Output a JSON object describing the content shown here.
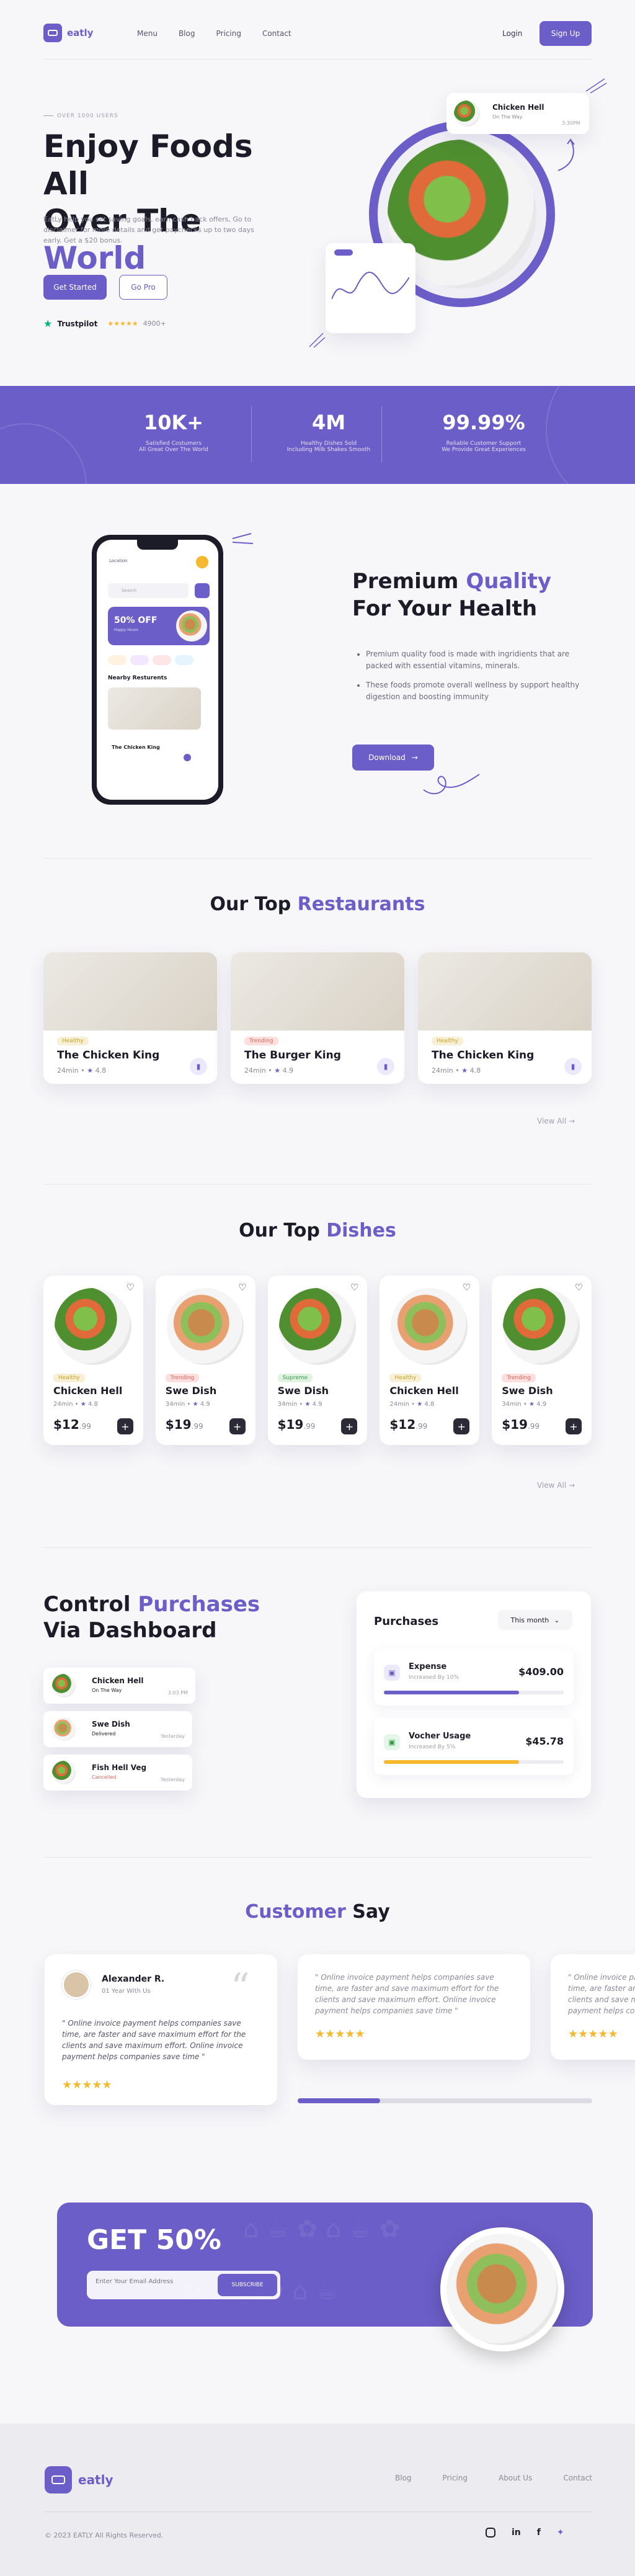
{
  "nav": {
    "logo": "eatly",
    "links": [
      "Menu",
      "Blog",
      "Pricing",
      "Contact"
    ],
    "login": "Login",
    "signup": "Sign Up"
  },
  "hero": {
    "kicker": "OVER 1000 USERS",
    "title_1": "Enjoy Foods All",
    "title_2a": "Over The ",
    "title_2b": "World",
    "desc": "EatLy help you set saving goals, earn cash back offers, Go to disclaimer for more details and get paychecks up to two days early. Get a $20 bonus.",
    "btn_start": "Get Started",
    "btn_pro": "Go Pro",
    "trustpilot": "Trustpilot",
    "rating": "4900+",
    "stars": "★★★★★",
    "floating_title": "Chicken Hell",
    "floating_sub": "On The Way",
    "floating_time": "3:30PM"
  },
  "stats": [
    {
      "value": "10K+",
      "label1": "Satisfied Costumers",
      "label2": "All Great Over The World"
    },
    {
      "value": "4M",
      "label1": "Healthy Dishes Sold",
      "label2": "Including Milk Shakes Smooth"
    },
    {
      "value": "99.99%",
      "label1": "Reliable Customer Support",
      "label2": "We Provide Great Experiences"
    }
  ],
  "premium": {
    "title_a": "Premium ",
    "title_b": "Quality",
    "title_c": "For Your Health",
    "bullets": [
      "Premium quality food is made with ingridients that are packed with essential vitamins, minerals.",
      "These foods promote overall wellness by support healthy digestion and boosting immunity"
    ],
    "download": "Download",
    "phone_loc": "Location",
    "phone_search": "Search",
    "phone_promo": "50% OFF",
    "phone_promo_sub": "Happy Hours",
    "phone_nearby": "Nearby Resturents",
    "phone_card": "The Chicken King"
  },
  "restaurants": {
    "title_a": "Our Top ",
    "title_b": "Restaurants",
    "view_all": "View All",
    "items": [
      {
        "tag": "Healthy",
        "name": "The Chicken King",
        "time": "24min •",
        "rating": "4.8",
        "tag_bg": "#f8f0d6",
        "tag_fg": "#c9a125"
      },
      {
        "tag": "Trending",
        "name": "The Burger King",
        "time": "24min •",
        "rating": "4.9",
        "tag_bg": "#fde0de",
        "tag_fg": "#e0655b"
      },
      {
        "tag": "Healthy",
        "name": "The Chicken King",
        "time": "24min •",
        "rating": "4.8",
        "tag_bg": "#f8f0d6",
        "tag_fg": "#c9a125"
      }
    ]
  },
  "dishes": {
    "title_a": "Our Top ",
    "title_b": "Dishes",
    "view_all": "View All",
    "items": [
      {
        "tag": "Healthy",
        "name": "Chicken Hell",
        "time": "24min •",
        "rating": "4.8",
        "price": "$12",
        "cents": ".99",
        "tag_bg": "#f8f0d6",
        "tag_fg": "#c9a125"
      },
      {
        "tag": "Trending",
        "name": "Swe Dish",
        "time": "34min •",
        "rating": "4.9",
        "price": "$19",
        "cents": ".99",
        "tag_bg": "#fde0de",
        "tag_fg": "#e0655b"
      },
      {
        "tag": "Supreme",
        "name": "Swe Dish",
        "time": "34min •",
        "rating": "4.9",
        "price": "$19",
        "cents": ".99",
        "tag_bg": "#dff3e0",
        "tag_fg": "#3a9a4a"
      },
      {
        "tag": "Healthy",
        "name": "Chicken Hell",
        "time": "24min •",
        "rating": "4.8",
        "price": "$12",
        "cents": ".99",
        "tag_bg": "#f8f0d6",
        "tag_fg": "#c9a125"
      },
      {
        "tag": "Trending",
        "name": "Swe Dish",
        "time": "34min •",
        "rating": "4.9",
        "price": "$19",
        "cents": ".99",
        "tag_bg": "#fde0de",
        "tag_fg": "#e0655b"
      }
    ]
  },
  "control": {
    "title_a": "Control ",
    "title_b": "Purchases",
    "title_c": "Via Dashboard",
    "orders": [
      {
        "name": "Chicken Hell",
        "status": "On The Way",
        "time": "3:03 PM",
        "color": "#1c1c28"
      },
      {
        "name": "Swe Dish",
        "status": "Delivered",
        "time": "Yesterday",
        "color": "#1c1c28"
      },
      {
        "name": "Fish Hell Veg",
        "status": "Cancelled",
        "time": "Yesterday",
        "color": "#e0655b"
      }
    ],
    "panel_title": "Purchases",
    "period": "This month",
    "rows": [
      {
        "name": "Expense",
        "sub": "Increased By 10%",
        "amount": "$409.00",
        "fill": 0.75,
        "color": "#6c5ec9"
      },
      {
        "name": "Vocher Usage",
        "sub": "Increased By 5%",
        "amount": "$45.78",
        "fill": 0.75,
        "color": "#f5b82e"
      }
    ]
  },
  "testimonials": {
    "title_a": "Customer ",
    "title_b": "Say",
    "name": "Alexander R.",
    "since": "01 Year With Us",
    "quote": "\" Online invoice payment helps companies save time, are faster and save maximum effort for the clients and save maximum effort. Online invoice payment helps companies save time \"",
    "stars": "★★★★★",
    "progress": 0.28
  },
  "promo": {
    "title": "GET 50%",
    "placeholder": "Enter Your Email Address",
    "btn": "SUBSCRIBE"
  },
  "footer": {
    "logo": "eatly",
    "links": [
      "Blog",
      "Pricing",
      "About Us",
      "Contact"
    ],
    "copy": "© 2023 EATLY All Rights Reserved.",
    "socials": [
      "instagram",
      "linkedin",
      "facebook",
      "twitter"
    ]
  }
}
